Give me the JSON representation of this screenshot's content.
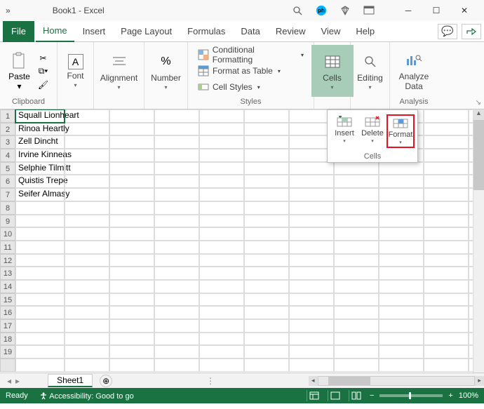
{
  "title": "Book1 - Excel",
  "tabs": {
    "file": "File",
    "home": "Home",
    "insert": "Insert",
    "page_layout": "Page Layout",
    "formulas": "Formulas",
    "data": "Data",
    "review": "Review",
    "view": "View",
    "help": "Help"
  },
  "ribbon": {
    "clipboard": {
      "paste": "Paste",
      "label": "Clipboard"
    },
    "font": {
      "label": "Font"
    },
    "alignment": {
      "label": "Alignment"
    },
    "number": {
      "label": "Number"
    },
    "styles": {
      "cf": "Conditional Formatting",
      "fat": "Format as Table",
      "cs": "Cell Styles",
      "label": "Styles"
    },
    "cells": {
      "label": "Cells"
    },
    "editing": {
      "label": "Editing"
    },
    "analysis": {
      "analyze": "Analyze",
      "data": "Data",
      "label": "Analysis"
    }
  },
  "dropdown": {
    "insert": "Insert",
    "delete": "Delete",
    "format": "Format",
    "label": "Cells"
  },
  "rows": [
    "Squall Lionheart",
    "Rinoa Heartly",
    "Zell Dincht",
    "Irvine Kinneas",
    "Selphie Tilmitt",
    "Quistis Trepe",
    "Seifer Almasy"
  ],
  "row_numbers": [
    "1",
    "2",
    "3",
    "4",
    "5",
    "6",
    "7",
    "8",
    "9",
    "10",
    "11",
    "12",
    "13",
    "14",
    "15",
    "16",
    "17",
    "18",
    "19"
  ],
  "sheet": {
    "name": "Sheet1"
  },
  "status": {
    "ready": "Ready",
    "acc": "Accessibility: Good to go",
    "zoom": "100%"
  }
}
